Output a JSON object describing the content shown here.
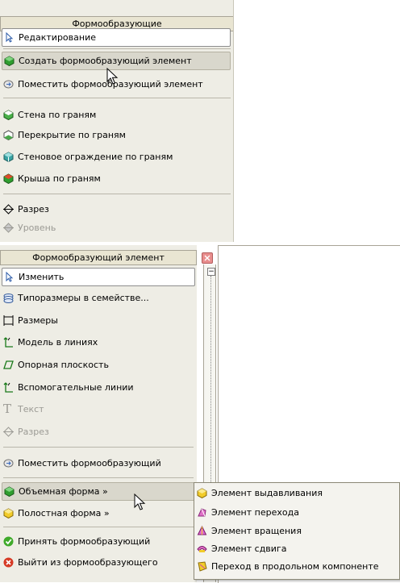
{
  "top_panel": {
    "title": "Формообразующие",
    "items": [
      {
        "label": "Редактирование"
      },
      {
        "label": "Создать формообразующий элемент"
      },
      {
        "label": "Поместить формообразующий элемент"
      },
      {
        "label": "Стена по граням"
      },
      {
        "label": "Перекрытие по граням"
      },
      {
        "label": "Стеновое ограждение по граням"
      },
      {
        "label": "Крыша по граням"
      },
      {
        "label": "Разрез"
      },
      {
        "label": "Уровень"
      }
    ]
  },
  "bottom_panel": {
    "title": "Формообразующий элемент",
    "items": [
      {
        "label": "Изменить"
      },
      {
        "label": "Типоразмеры в семействе..."
      },
      {
        "label": "Размеры"
      },
      {
        "label": "Модель в линиях"
      },
      {
        "label": "Опорная плоскость"
      },
      {
        "label": "Вспомогательные линии"
      },
      {
        "label": "Текст"
      },
      {
        "label": "Разрез"
      },
      {
        "label": "Поместить формообразующий"
      },
      {
        "label": "Объемная форма »"
      },
      {
        "label": "Полостная форма »"
      },
      {
        "label": "Принять формообразующий"
      },
      {
        "label": "Выйти из формообразующего"
      }
    ]
  },
  "submenu": {
    "items": [
      {
        "label": "Элемент выдавливания"
      },
      {
        "label": "Элемент перехода"
      },
      {
        "label": "Элемент вращения"
      },
      {
        "label": "Элемент сдвига"
      },
      {
        "label": "Переход в продольном компоненте"
      }
    ]
  },
  "tree_expander": "−"
}
